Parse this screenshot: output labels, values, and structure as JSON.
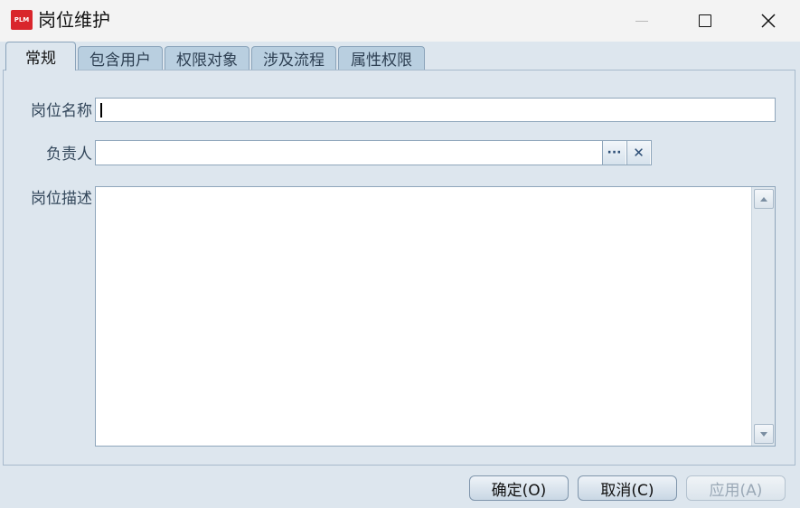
{
  "window": {
    "title": "岗位维护",
    "logo_text": "PLM",
    "colors": {
      "logo": "#d9262c",
      "panel": "#dde6ee",
      "tab": "#b9cfe0"
    }
  },
  "tabs": [
    {
      "label": "常规",
      "active": true
    },
    {
      "label": "包含用户",
      "active": false
    },
    {
      "label": "权限对象",
      "active": false
    },
    {
      "label": "涉及流程",
      "active": false
    },
    {
      "label": "属性权限",
      "active": false
    }
  ],
  "form": {
    "position_name": {
      "label": "岗位名称",
      "value": ""
    },
    "owner": {
      "label": "负责人",
      "value": "",
      "browse_glyph": "···",
      "clear_glyph": "✕"
    },
    "description": {
      "label": "岗位描述",
      "value": ""
    }
  },
  "buttons": {
    "ok": "确定(O)",
    "cancel": "取消(C)",
    "apply": "应用(A)"
  },
  "icons": [
    "app-logo-icon",
    "minimize-icon",
    "maximize-icon",
    "close-icon",
    "browse-icon",
    "clear-icon",
    "scroll-up-icon",
    "scroll-down-icon"
  ]
}
